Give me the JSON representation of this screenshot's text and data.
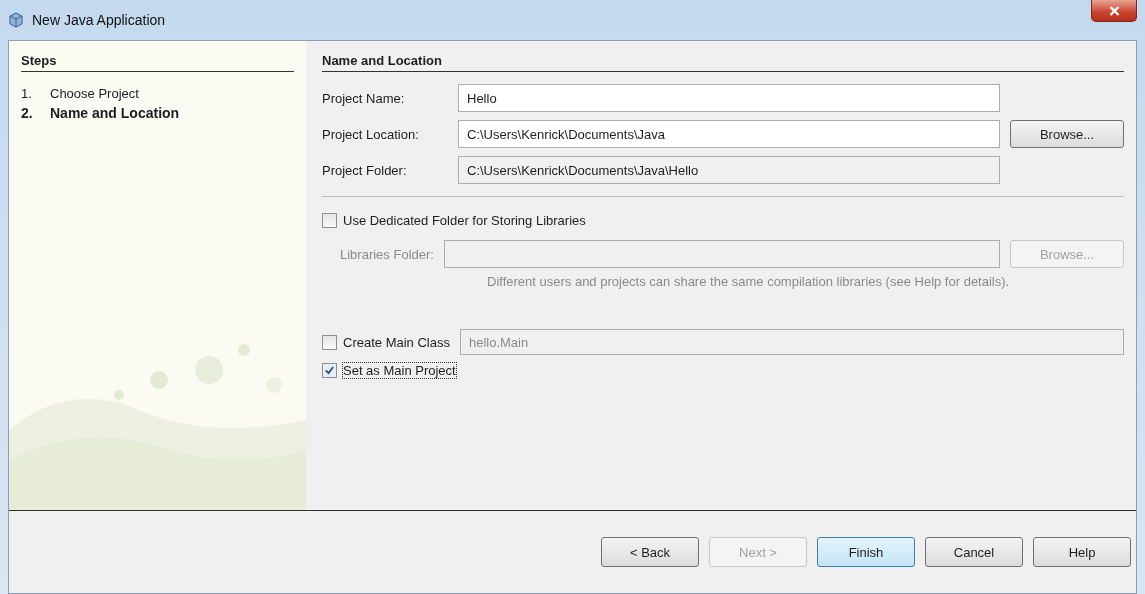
{
  "window": {
    "title": "New Java Application"
  },
  "steps": {
    "title": "Steps",
    "items": [
      {
        "number": "1.",
        "label": "Choose Project",
        "selected": false
      },
      {
        "number": "2.",
        "label": "Name and Location",
        "selected": true
      }
    ]
  },
  "panel": {
    "title": "Name and Location",
    "fields": [
      {
        "label": "Project Name:",
        "value": "Hello",
        "editable": true
      },
      {
        "label": "Project Location:",
        "value": "C:\\Users\\Kenrick\\Documents\\Java",
        "editable": true,
        "button": {
          "label": "Browse...",
          "disabled": false
        }
      },
      {
        "label": "Project Folder:",
        "value": "C:\\Users\\Kenrick\\Documents\\Java\\Hello",
        "editable": false
      }
    ],
    "libraries": {
      "checkbox": {
        "label": "Use Dedicated Folder for Storing Libraries",
        "checked": false
      },
      "label": "Libraries Folder:",
      "disabled": true,
      "button": {
        "label": "Browse...",
        "disabled": true
      },
      "hint": "Different users and projects can share the same compilation libraries (see Help for details)."
    },
    "main_class": {
      "checkbox": {
        "label": "Create Main Class",
        "checked": false
      },
      "value": "hello.Main",
      "disabled": true
    },
    "main_project": {
      "label": "Set as Main Project",
      "checked": true,
      "focused": true
    }
  },
  "buttons": [
    {
      "label": "< Back",
      "disabled": false,
      "default": false
    },
    {
      "label": "Next >",
      "disabled": true,
      "default": false
    },
    {
      "label": "Finish",
      "disabled": false,
      "default": true
    },
    {
      "label": "Cancel",
      "disabled": false,
      "default": false
    },
    {
      "label": "Help",
      "disabled": false,
      "default": false
    }
  ]
}
